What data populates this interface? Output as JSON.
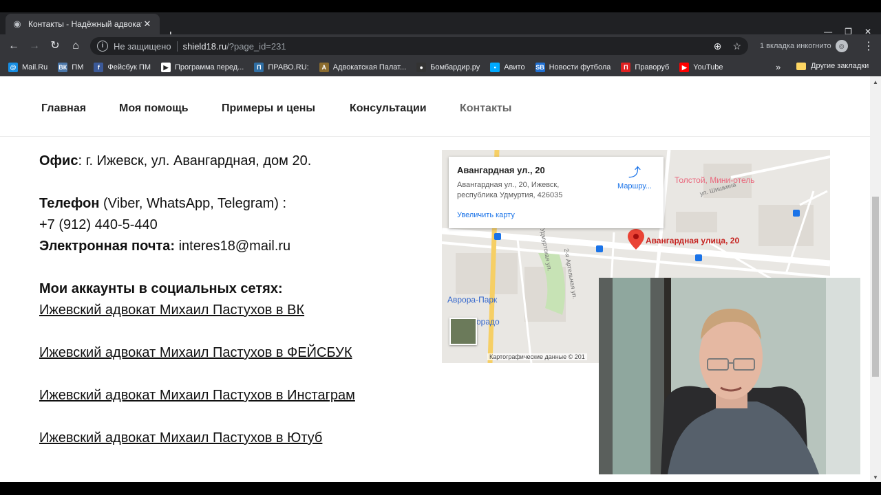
{
  "browser": {
    "tab_title": "Контакты - Надёжный адвокат",
    "new_tab": "+",
    "security_label": "Не защищено",
    "url_host": "shield18.ru",
    "url_path": "/?page_id=231",
    "incognito_label": "1 вкладка инкогнито"
  },
  "bookmarks": [
    {
      "label": "Mail.Ru",
      "color": "#168de2",
      "glyph": "@"
    },
    {
      "label": "ПМ",
      "color": "#4a76a8",
      "glyph": "ВК"
    },
    {
      "label": "Фейсбук ПМ",
      "color": "#3b5998",
      "glyph": "f"
    },
    {
      "label": "Программа перед...",
      "color": "#ffffff",
      "glyph": "▶"
    },
    {
      "label": "ПРАВО.RU:",
      "color": "#2f6ea3",
      "glyph": "П"
    },
    {
      "label": "Адвокатская Палат...",
      "color": "#8a6b2e",
      "glyph": "А"
    },
    {
      "label": "Бомбардир.ру",
      "color": "#333333",
      "glyph": "●"
    },
    {
      "label": "Авито",
      "color": "#00aaff",
      "glyph": "•"
    },
    {
      "label": "Новости футбола",
      "color": "#1f6fd1",
      "glyph": "SB"
    },
    {
      "label": "Праворуб",
      "color": "#e02020",
      "glyph": "П"
    },
    {
      "label": "YouTube",
      "color": "#ff0000",
      "glyph": "▶"
    }
  ],
  "bookmarks_more": "»",
  "other_bookmarks": "Другие закладки",
  "site_nav": {
    "home": "Главная",
    "help": "Моя помощь",
    "examples": "Примеры и цены",
    "consult": "Консультации",
    "contacts": "Контакты"
  },
  "contact": {
    "office_label": "Офис",
    "office_value": ": г. Ижевск, ул. Авангардная, дом 20.",
    "phone_label": "Телефон",
    "phone_apps": " (Viber, WhatsApp, Telegram) :",
    "phone_number": "+7 (912) 440-5-440",
    "email_label": "Электронная почта:",
    "email_value": " interes18@mail.ru",
    "social_heading": "Мои аккаунты в социальных сетях:",
    "links": [
      "Ижевский адвокат Михаил Пастухов в ВК",
      "Ижевский адвокат Михаил Пастухов в ФЕЙСБУК",
      "Ижевский адвокат Михаил Пастухов в Инстаграм",
      "Ижевский адвокат Михаил Пастухов в Ютуб"
    ]
  },
  "map": {
    "card_title": "Авангардная ул., 20",
    "card_address": "Авангардная ул., 20, Ижевск, республика Удмуртия, 426035",
    "enlarge": "Увеличить карту",
    "route": "Маршру...",
    "marker_label": "Авангардная улица, 20",
    "poi_hotel": "Толстой, Мини-отель",
    "poi_park": "Аврора-Парк",
    "poi_dorado": "орадо",
    "street_shishkina": "ул. Шишкина",
    "street_udmurt": "Удмуртская ул.",
    "street_arterial": "2-я Артельная ул.",
    "copyright": "Картографические данные © 201"
  }
}
